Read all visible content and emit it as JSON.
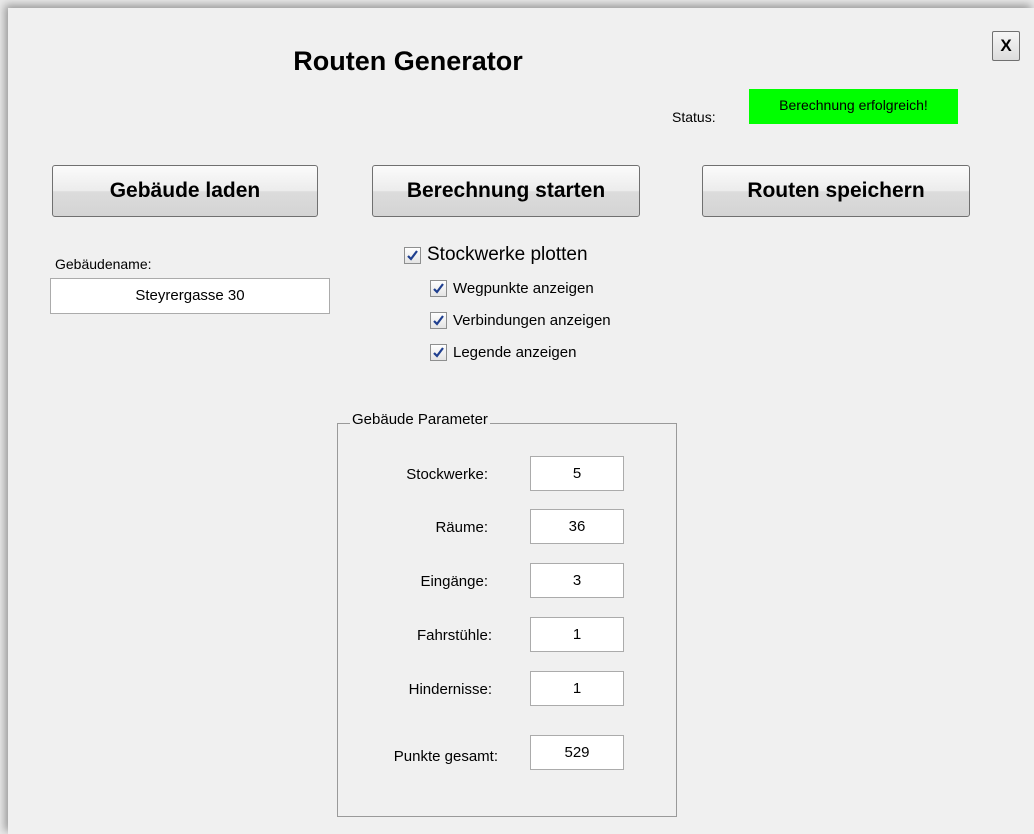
{
  "title": "Routen Generator",
  "close_label": "X",
  "status": {
    "label": "Status:",
    "value": "Berechnung erfolgreich!",
    "color": "#00ff00"
  },
  "buttons": {
    "load": "Gebäude laden",
    "start": "Berechnung starten",
    "save": "Routen speichern"
  },
  "building": {
    "name_label": "Gebäudename:",
    "name_value": "Steyrergasse 30"
  },
  "plot_options": {
    "floors": {
      "label": "Stockwerke plotten",
      "checked": true
    },
    "waypoints": {
      "label": "Wegpunkte anzeigen",
      "checked": true
    },
    "connections": {
      "label": "Verbindungen anzeigen",
      "checked": true
    },
    "legend": {
      "label": "Legende anzeigen",
      "checked": true
    }
  },
  "parameters": {
    "title": "Gebäude Parameter",
    "floors": {
      "label": "Stockwerke:",
      "value": "5"
    },
    "rooms": {
      "label": "Räume:",
      "value": "36"
    },
    "entrances": {
      "label": "Eingänge:",
      "value": "3"
    },
    "elevators": {
      "label": "Fahrstühle:",
      "value": "1"
    },
    "obstacles": {
      "label": "Hindernisse:",
      "value": "1"
    },
    "total_points": {
      "label": "Punkte gesamt:",
      "value": "529"
    }
  }
}
